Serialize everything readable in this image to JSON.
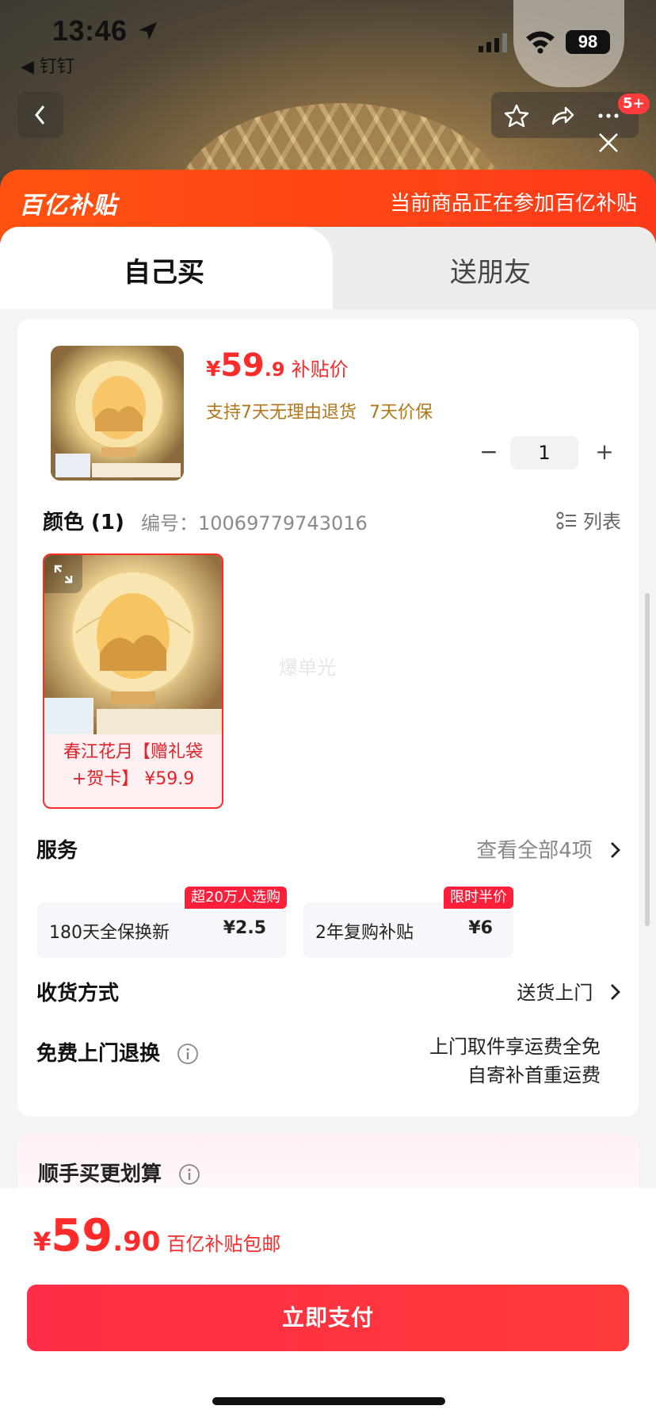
{
  "status_bar": {
    "time": "13:46",
    "back_app": "◀ 钉钉",
    "battery": "98"
  },
  "nav": {
    "badge": "5+"
  },
  "banner": {
    "logo": "百亿补贴",
    "message": "当前商品正在参加百亿补贴"
  },
  "tabs": [
    {
      "label": "自己买",
      "active": true
    },
    {
      "label": "送朋友",
      "active": false
    }
  ],
  "product": {
    "price_symbol": "¥",
    "price_int": "59",
    "price_dec": ".9",
    "price_tag": "补贴价",
    "promise_1": "支持7天无理由退货",
    "promise_2": "7天价保",
    "quantity": "1",
    "minus": "−",
    "plus": "+"
  },
  "color": {
    "label": "颜色 (1)",
    "sku": "编号：10069779743016",
    "list_label": "列表"
  },
  "variant": {
    "label": "春江花月【赠礼袋+贺卡】 ¥59.9",
    "watermark": "爆单光"
  },
  "services": {
    "title": "服务",
    "more": "查看全部4项",
    "items": [
      {
        "name": "180天全保换新",
        "price": "¥2.5",
        "flag": "超20万人选购"
      },
      {
        "name": "2年复购补贴",
        "price": "¥6",
        "flag": "限时半价"
      }
    ]
  },
  "shipping": {
    "title": "收货方式",
    "value": "送货上门"
  },
  "returns": {
    "title": "免费上门退换",
    "line_1": "上门取件享运费全免",
    "line_2": "自寄补首重运费"
  },
  "upsell": {
    "title": "顺手买更划算"
  },
  "bottom": {
    "price_symbol": "¥",
    "price_int": "59",
    "price_dec": ".90",
    "note": "百亿补贴包邮",
    "pay_label": "立即支付"
  },
  "colors": {
    "accent_red": "#ff2b2b",
    "banner_orange": "#ff5210",
    "promise_gold": "#b0761a"
  }
}
